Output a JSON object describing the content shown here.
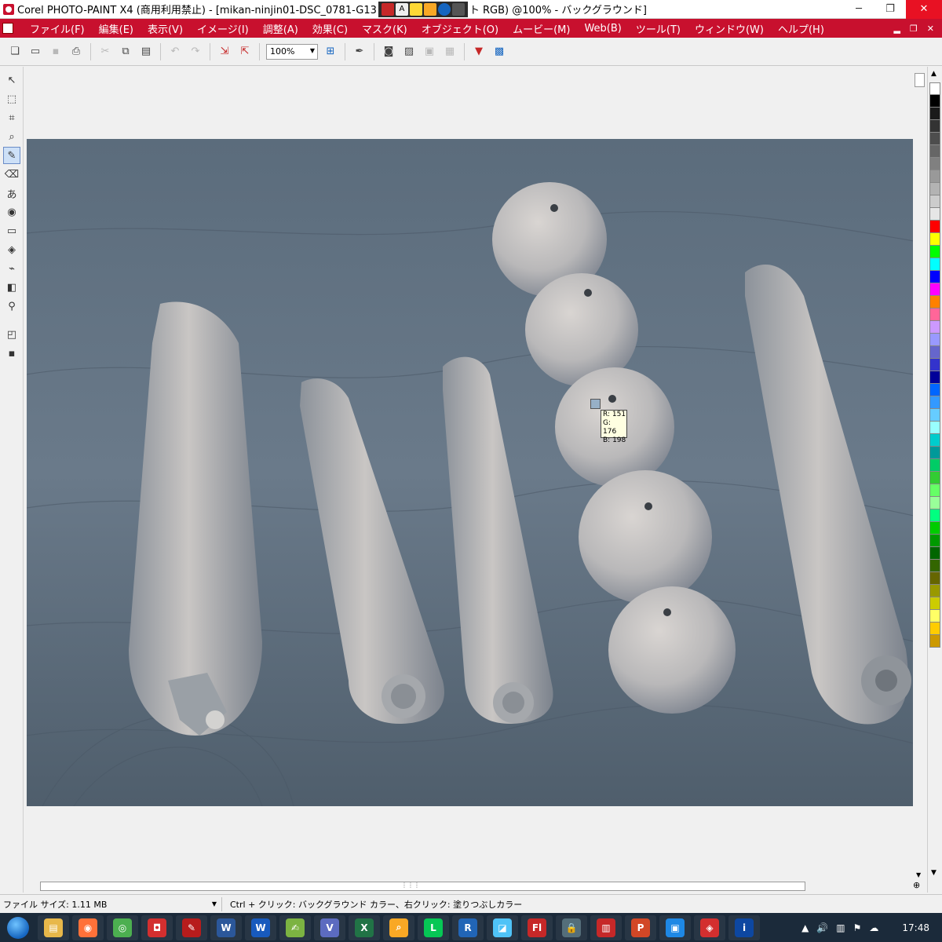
{
  "window": {
    "title_part1": "Corel PHOTO-PAINT X4 (商用利用禁止) - [mikan-ninjin01-DSC_0781-G13",
    "title_part2": "ト RGB) @100% - バックグラウンド]",
    "minimize": "─",
    "restore": "❐",
    "close": "✕"
  },
  "menu": {
    "items": [
      "ファイル(F)",
      "編集(E)",
      "表示(V)",
      "イメージ(I)",
      "調整(A)",
      "効果(C)",
      "マスク(K)",
      "オブジェクト(O)",
      "ムービー(M)",
      "Web(B)",
      "ツール(T)",
      "ウィンドウ(W)",
      "ヘルプ(H)"
    ],
    "mdi_minimize": "▂",
    "mdi_restore": "❐",
    "mdi_close": "✕"
  },
  "toolbar": {
    "zoom_value": "100%"
  },
  "tooltip": {
    "r": "R: 151",
    "g": "G: 176",
    "b": "B: 198",
    "sample_color": "#97b0c6"
  },
  "status": {
    "file_size": "ファイル サイズ: 1.11 MB",
    "hint": "Ctrl + クリック: バックグラウンド カラー、右クリック: 塗りつぶしカラー"
  },
  "palette": {
    "colors": [
      "#ffffff",
      "#000000",
      "#1a1a1a",
      "#333333",
      "#4d4d4d",
      "#666666",
      "#808080",
      "#999999",
      "#b3b3b3",
      "#cccccc",
      "#e6e6e6",
      "#ff0000",
      "#ffff00",
      "#00ff00",
      "#00ffff",
      "#0000ff",
      "#ff00ff",
      "#ff8000",
      "#ff6699",
      "#cc99ff",
      "#9999ff",
      "#6666cc",
      "#3333cc",
      "#000099",
      "#0066ff",
      "#3399ff",
      "#66ccff",
      "#99ffff",
      "#00cccc",
      "#009999",
      "#00cc66",
      "#33cc33",
      "#66ff66",
      "#99ff99",
      "#00ff80",
      "#00cc00",
      "#009900",
      "#006600",
      "#336600",
      "#666600",
      "#999900",
      "#cccc00",
      "#ffff66",
      "#ffcc00",
      "#cc9900"
    ]
  },
  "taskbar": {
    "clock": "17:48",
    "apps": [
      {
        "name": "explorer",
        "glyph": "▤",
        "color": "#e8b84a"
      },
      {
        "name": "firefox",
        "glyph": "◉",
        "color": "#ff7139"
      },
      {
        "name": "chrome",
        "glyph": "◎",
        "color": "#4caf50"
      },
      {
        "name": "photo-paint",
        "glyph": "◘",
        "color": "#d32f2f"
      },
      {
        "name": "app-red",
        "glyph": "✎",
        "color": "#b71c1c"
      },
      {
        "name": "word-2003",
        "glyph": "W",
        "color": "#2b579a"
      },
      {
        "name": "word",
        "glyph": "W",
        "color": "#185abd"
      },
      {
        "name": "app-green",
        "glyph": "✍",
        "color": "#7cb342"
      },
      {
        "name": "app-vs",
        "glyph": "V",
        "color": "#5c6bc0"
      },
      {
        "name": "excel",
        "glyph": "X",
        "color": "#217346"
      },
      {
        "name": "search-app",
        "glyph": "⌕",
        "color": "#f9a825"
      },
      {
        "name": "line",
        "glyph": "L",
        "color": "#06c755"
      },
      {
        "name": "r-app",
        "glyph": "R",
        "color": "#2165b6"
      },
      {
        "name": "app-glass",
        "glyph": "◪",
        "color": "#4fc3f7"
      },
      {
        "name": "flash",
        "glyph": "Fl",
        "color": "#c62828"
      },
      {
        "name": "app-lock",
        "glyph": "🔒",
        "color": "#546e7a"
      },
      {
        "name": "app-bank",
        "glyph": "▥",
        "color": "#c62828"
      },
      {
        "name": "powerpoint",
        "glyph": "P",
        "color": "#d24726"
      },
      {
        "name": "app-screen",
        "glyph": "▣",
        "color": "#1e88e5"
      },
      {
        "name": "app-corel2",
        "glyph": "◈",
        "color": "#d32f2f"
      },
      {
        "name": "info-app",
        "glyph": "i",
        "color": "#0d47a1"
      }
    ]
  }
}
